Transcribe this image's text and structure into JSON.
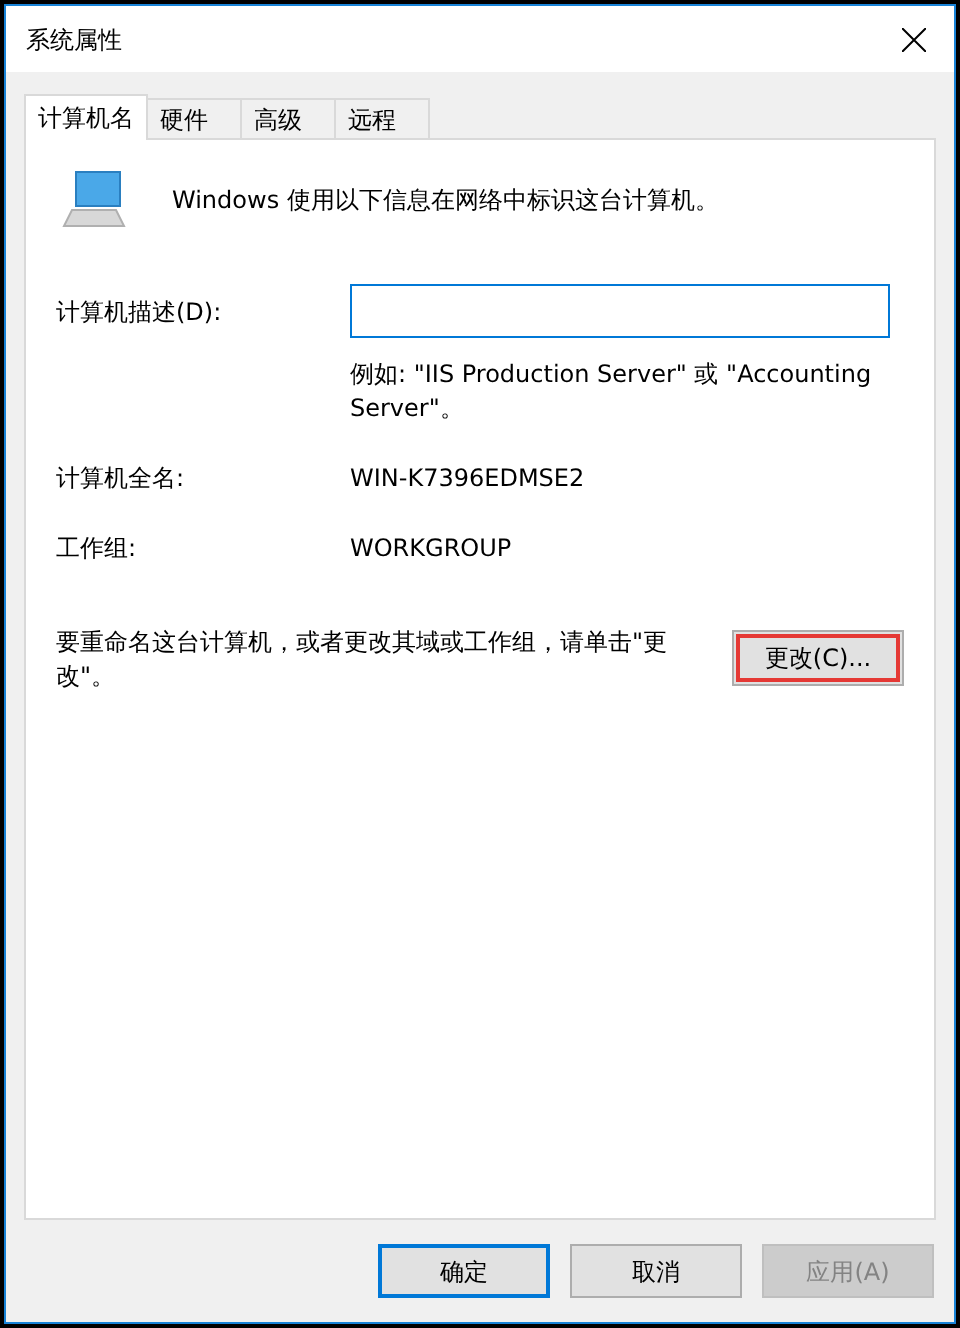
{
  "window": {
    "title": "系统属性"
  },
  "tabs": [
    {
      "label": "计算机名",
      "selected": true
    },
    {
      "label": "硬件",
      "selected": false
    },
    {
      "label": "高级",
      "selected": false
    },
    {
      "label": "远程",
      "selected": false
    }
  ],
  "intro": "Windows 使用以下信息在网络中标识这台计算机。",
  "description_field": {
    "label": "计算机描述(D):",
    "focused": true
  },
  "example": "例如: \"IIS Production Server\" 或 \"Accounting Server\"。",
  "info_rows": [
    {
      "label": "计算机全名:",
      "value": "WIN-K7396EDMSE2"
    },
    {
      "label": "工作组:",
      "value": "WORKGROUP"
    }
  ],
  "rename_text": "要重命名这台计算机，或者更改其域或工作组，请单击\"更改\"。",
  "change_button": {
    "label": "更改(C)...",
    "highlighted": true
  },
  "buttons": [
    {
      "label": "确定",
      "default": true,
      "disabled": false
    },
    {
      "label": "取消",
      "default": false,
      "disabled": false
    },
    {
      "label": "应用(A)",
      "default": false,
      "disabled": true
    }
  ]
}
